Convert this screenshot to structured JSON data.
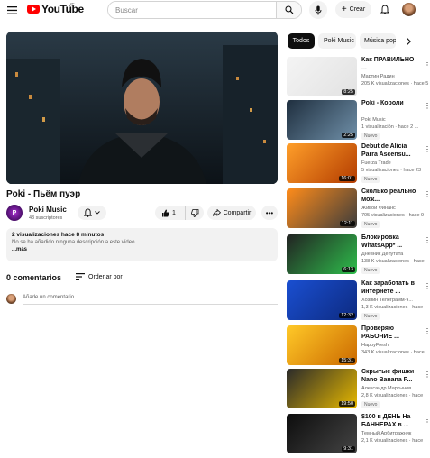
{
  "header": {
    "logo_text": "YouTube",
    "logo_country": "VE",
    "search_placeholder": "Buscar",
    "create_label": "Crear"
  },
  "video": {
    "title": "Poki - Пьём пуэр",
    "channel_name": "Poki Music",
    "subscribers": "43 suscriptores",
    "likes": "1",
    "share_label": "Compartir",
    "views_line": "2 visualizaciones  hace 8 minutos",
    "description": "No se ha añadido ninguna descripción a este vídeo.",
    "more_label": "...más"
  },
  "comments": {
    "count_label": "0 comentarios",
    "sort_label": "Ordenar por",
    "add_placeholder": "Añade un comentario..."
  },
  "chips": [
    "Todos",
    "Poki Music",
    "Música pop"
  ],
  "recommendations": [
    {
      "title": "Как ПРАВИЛЬНО ...",
      "channel": "Мартин Радин",
      "meta": "205 K visualizaciones · hace 5",
      "badge": "",
      "duration": "8:25",
      "thumb_colors": [
        "#f4f4f4",
        "#e2e2e2"
      ]
    },
    {
      "title": "Poki - Короли",
      "channel": "Poki Music",
      "meta": "1 visualización · hace 2 ...",
      "badge": "Nuevo",
      "duration": "2:25",
      "thumb_colors": [
        "#1f2f3f",
        "#6f8fa8"
      ]
    },
    {
      "title": "Debut de Alicia Parra Ascensu...",
      "channel": "Fuerza Trade",
      "meta": "5 visualizaciones · hace 23",
      "badge": "Nuevo",
      "duration": "16:01",
      "thumb_colors": [
        "#ff9f2a",
        "#b33c00"
      ]
    },
    {
      "title": "Сколько реально мож...",
      "channel": "Живой Финанс",
      "meta": "705 visualizaciones · hace 9",
      "badge": "Nuevo",
      "duration": "12:11",
      "thumb_colors": [
        "#ff8c1a",
        "#3c3c3c"
      ]
    },
    {
      "title": "Блокировка WhatsApp* ...",
      "channel": "Дневник Депутата",
      "meta": "138 K visualizaciones · hace",
      "badge": "Nuevo",
      "duration": "6:13",
      "thumb_colors": [
        "#222222",
        "#2ebd4b"
      ]
    },
    {
      "title": "Как заработать в интернете ...",
      "channel": "Хозяин Телеграмм·ч...",
      "meta": "1,3 K visualizaciones · hace",
      "badge": "Nuevo",
      "duration": "12:32",
      "thumb_colors": [
        "#1a4fd1",
        "#0d2a80"
      ]
    },
    {
      "title": "Проверяю РАБОЧИЕ ...",
      "channel": "HappyFresh",
      "meta": "343 K visualizaciones · hace",
      "badge": "",
      "duration": "15:31",
      "thumb_colors": [
        "#ffc928",
        "#cc6a00"
      ]
    },
    {
      "title": "Скрытые фишки Nano Banana P...",
      "channel": "Александр Мартынов",
      "meta": "2,8 K visualizaciones · hace",
      "badge": "Nuevo",
      "duration": "19:50",
      "thumb_colors": [
        "#2a2a2a",
        "#e6b800"
      ]
    },
    {
      "title": "$100 в ДЕНЬ На БАННЕРАХ в ...",
      "channel": "Темный Арбитражник",
      "meta": "2,1 K visualizaciones · hace",
      "badge": "",
      "duration": "9:31",
      "thumb_colors": [
        "#0d0d0d",
        "#444444"
      ]
    }
  ]
}
